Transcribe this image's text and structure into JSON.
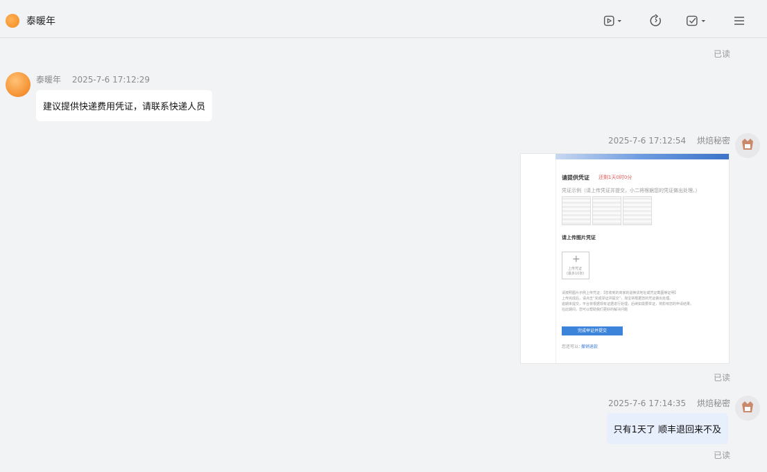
{
  "header": {
    "title": "泰暖年",
    "icons": [
      "video-dropdown-icon",
      "refresh-icon",
      "check-dropdown-icon",
      "menu-icon"
    ]
  },
  "read_label": "已读",
  "messages": [
    {
      "sender": "泰暖年",
      "time": "2025-7-6 17:12:29",
      "text": "建议提供快递费用凭证，请联系快递人员",
      "direction": "incoming"
    },
    {
      "sender": "烘焙秘密",
      "time": "2025-7-6 17:12:54",
      "type": "image",
      "direction": "outgoing",
      "image": {
        "heading": "请提供凭证",
        "countdown": "还剩1天0时0分",
        "example_label": "凭证示例（请上传凭证并提交，小二将根据您的凭证做出处理。）",
        "upload_heading": "请上传图片凭证",
        "upload_hint": "上传凭证",
        "upload_sub": "(最多10张)",
        "notes": [
          "请按照图片示例上传凭证：【您收到的商家的退换货地址或凭证截图等证明】",
          "上传完成后，请点击“完成举证并提交”，淘宝将根据您的凭证做出处理。",
          "逾期未提交，平台将根据现有证据进行处理，后续如需要举证，将影响您的申请结果。",
          "在此期间，您可以帮助我们更好的解决问题"
        ],
        "submit_label": "完成举证并提交",
        "footer_label": "您还可以：",
        "footer_link": "撤销退款"
      }
    },
    {
      "sender": "烘焙秘密",
      "time": "2025-7-6 17:14:35",
      "text": "只有1天了  顺丰退回来不及",
      "direction": "outgoing"
    }
  ]
}
